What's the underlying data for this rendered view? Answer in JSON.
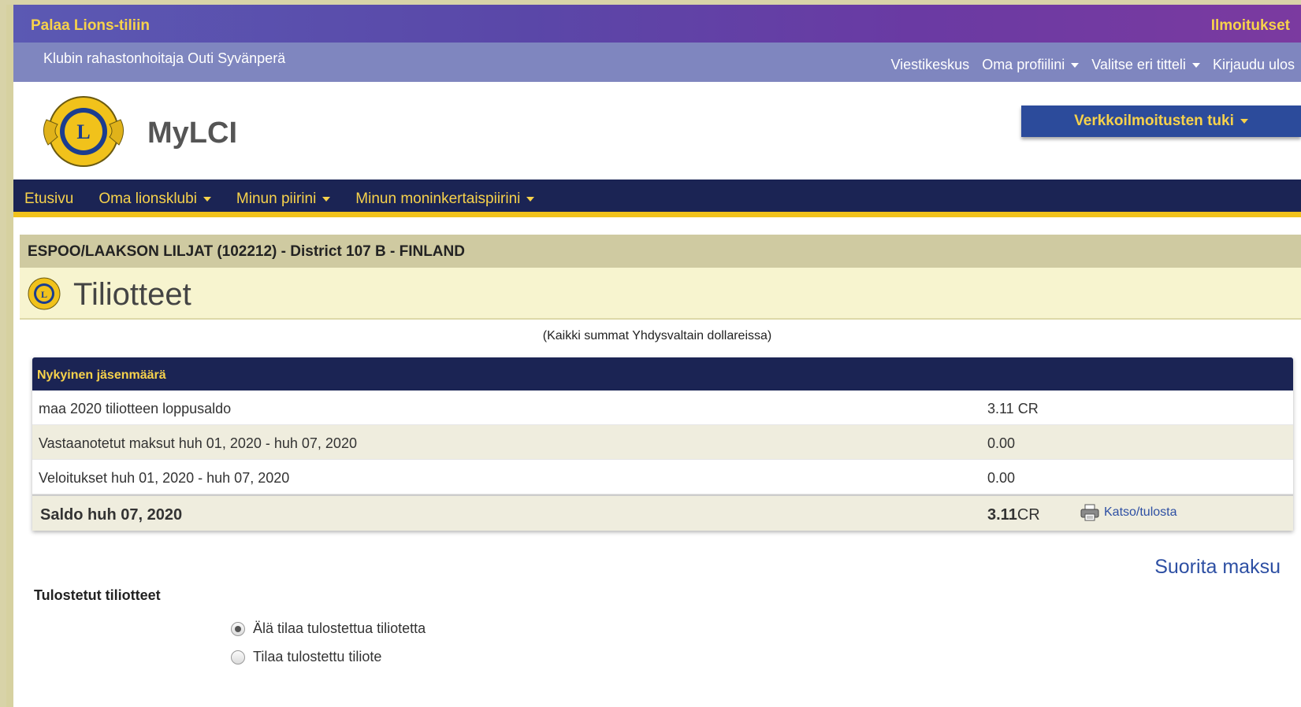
{
  "topbar": {
    "back_label": "Palaa Lions-tiliin",
    "notifications_label": "Ilmoitukset"
  },
  "subbar": {
    "role": "Klubin rahastonhoitaja Outi Syvänperä",
    "links": [
      "Viestikeskus",
      "Oma profiilini",
      "Valitse eri titteli",
      "Kirjaudu ulos"
    ]
  },
  "brand": {
    "name": "MyLCI",
    "support_label": "Verkkoilmoitusten tuki"
  },
  "nav": [
    "Etusivu",
    "Oma lionsklubi",
    "Minun piirini",
    "Minun moninkertaispiirini"
  ],
  "club": {
    "line": "ESPOO/LAAKSON LILJAT (102212) - District 107 B - FINLAND"
  },
  "page": {
    "title": "Tiliotteet",
    "currency_note": "(Kaikki summat Yhdysvaltain dollareissa)"
  },
  "statement": {
    "header": "Nykyinen jäsenmäärä",
    "rows": [
      {
        "label": "maa 2020 tiliotteen loppusaldo",
        "value": "3.11 CR"
      },
      {
        "label": "Vastaanotetut maksut huh 01, 2020 - huh 07, 2020",
        "value": "0.00"
      },
      {
        "label": "Veloitukset huh 01, 2020 - huh 07, 2020",
        "value": "0.00"
      }
    ],
    "total_label": "Saldo huh 07, 2020",
    "total_amount": "3.11",
    "total_suffix": "CR",
    "print_label": "Katso/tulosta"
  },
  "pay_label": "Suorita maksu",
  "printed": {
    "heading": "Tulostetut tiliotteet",
    "options": [
      "Älä tilaa tulostettua tiliotetta",
      "Tilaa tulostettu tiliote"
    ],
    "selected_index": 0
  },
  "colors": {
    "nav_bg": "#1b2454",
    "accent_yellow": "#f7d24b",
    "link_blue": "#2d4fa3"
  }
}
